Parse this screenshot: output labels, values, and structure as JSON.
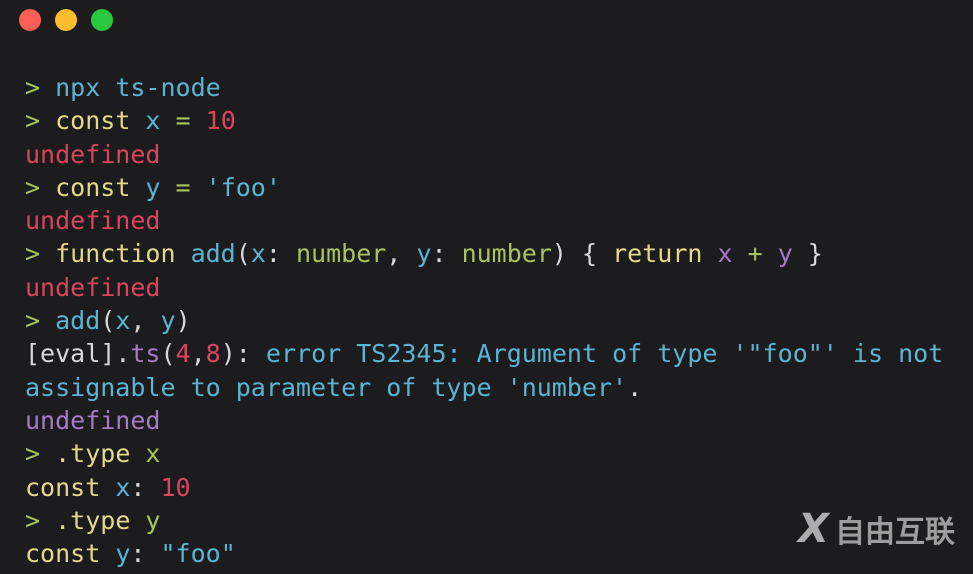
{
  "window": {
    "controls": [
      "close",
      "minimize",
      "maximize"
    ]
  },
  "colors": {
    "prompt": "#a9c45c",
    "cyan": "#5cb4d3",
    "yellow": "#e3d98a",
    "red": "#d8455c",
    "purple": "#a57ac6",
    "green": "#a9c45c",
    "white": "#d8d8d8",
    "background": "#1c1c1e"
  },
  "lines": [
    [
      [
        ">",
        "prompt"
      ],
      [
        " npx ts-node",
        "cyan"
      ]
    ],
    [
      [
        ">",
        "prompt"
      ],
      [
        " const",
        "yellow"
      ],
      [
        " x",
        "cyan"
      ],
      [
        " =",
        "green"
      ],
      [
        " 10",
        "red"
      ]
    ],
    [
      [
        "undefined",
        "red"
      ]
    ],
    [
      [
        ">",
        "prompt"
      ],
      [
        " const",
        "yellow"
      ],
      [
        " y",
        "cyan"
      ],
      [
        " =",
        "green"
      ],
      [
        " 'foo'",
        "cyan"
      ]
    ],
    [
      [
        "undefined",
        "red"
      ]
    ],
    [
      [
        ">",
        "prompt"
      ],
      [
        " function",
        "yellow"
      ],
      [
        " add",
        "cyan"
      ],
      [
        "(",
        "white"
      ],
      [
        "x",
        "cyan"
      ],
      [
        ":",
        "white"
      ],
      [
        " number",
        "green"
      ],
      [
        ",",
        "white"
      ],
      [
        " y",
        "cyan"
      ],
      [
        ":",
        "white"
      ],
      [
        " number",
        "green"
      ],
      [
        ")",
        "white"
      ],
      [
        " {",
        "white"
      ],
      [
        " return",
        "yellow"
      ],
      [
        " x",
        "purple"
      ],
      [
        " +",
        "green"
      ],
      [
        " y",
        "purple"
      ],
      [
        " }",
        "white"
      ]
    ],
    [
      [
        "undefined",
        "red"
      ]
    ],
    [
      [
        ">",
        "prompt"
      ],
      [
        " add",
        "cyan"
      ],
      [
        "(",
        "white"
      ],
      [
        "x",
        "cyan"
      ],
      [
        ",",
        "white"
      ],
      [
        " y",
        "cyan"
      ],
      [
        ")",
        "white"
      ]
    ],
    [
      [
        "[eval]",
        "white"
      ],
      [
        ".",
        "white"
      ],
      [
        "ts",
        "purple"
      ],
      [
        "(",
        "white"
      ],
      [
        "4",
        "red"
      ],
      [
        ",",
        "white"
      ],
      [
        "8",
        "red"
      ],
      [
        ")",
        "white"
      ],
      [
        ":",
        "white"
      ],
      [
        " error TS2345: Argument of type '\"foo\"' is not",
        "cyan"
      ]
    ],
    [
      [
        "assignable to parameter of type 'number'",
        "cyan"
      ],
      [
        ".",
        "white"
      ]
    ],
    [
      [
        "undefined",
        "purple"
      ]
    ],
    [
      [
        ">",
        "prompt"
      ],
      [
        " .type",
        "yellow"
      ],
      [
        " x",
        "green"
      ]
    ],
    [
      [
        "const",
        "yellow"
      ],
      [
        " x",
        "cyan"
      ],
      [
        ":",
        "white"
      ],
      [
        " 10",
        "red"
      ]
    ],
    [
      [
        ">",
        "prompt"
      ],
      [
        " .type",
        "yellow"
      ],
      [
        " y",
        "green"
      ]
    ],
    [
      [
        "const",
        "yellow"
      ],
      [
        " y",
        "cyan"
      ],
      [
        ":",
        "white"
      ],
      [
        " \"foo\"",
        "cyan"
      ]
    ]
  ],
  "watermark": {
    "mark": "X",
    "text": "自由互联"
  }
}
